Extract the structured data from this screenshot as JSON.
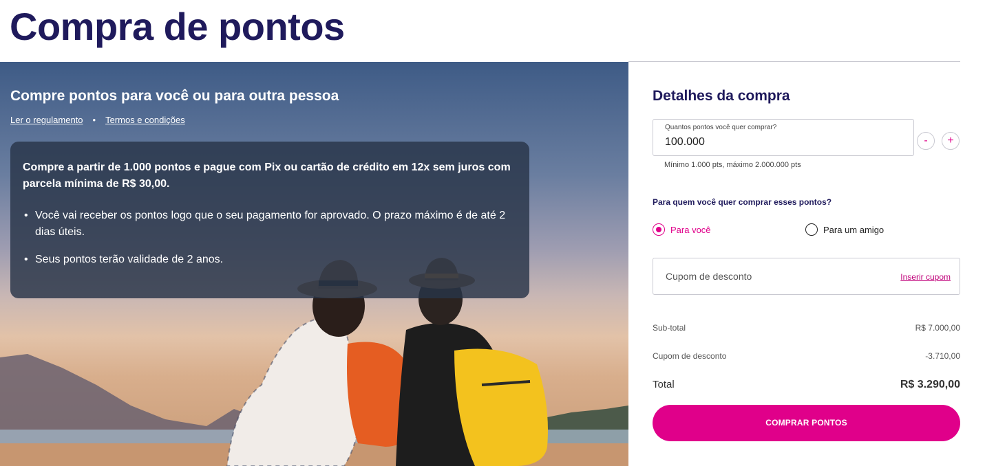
{
  "page": {
    "title": "Compra de pontos"
  },
  "hero": {
    "heading": "Compre pontos para você ou para outra pessoa",
    "links": [
      {
        "label": "Ler o regulamento"
      },
      {
        "label": "Termos e condições"
      }
    ],
    "separator": "•",
    "info": {
      "intro": "Compre a partir de 1.000 pontos e pague com Pix ou cartão de crédito em 12x sem juros com parcela mínima de R$ 30,00.",
      "bullets": [
        "Você vai receber os pontos logo que o seu pagamento for aprovado. O prazo máximo é de até 2 dias úteis.",
        "Seus pontos terão validade de 2 anos."
      ]
    },
    "image_description_icon": "beach-couple-photo"
  },
  "purchase": {
    "title": "Detalhes da compra",
    "points_field": {
      "label": "Quantos pontos você quer comprar?",
      "value": "100.000",
      "hint": "Mínimo 1.000 pts, máximo 2.000.000 pts"
    },
    "stepper": {
      "minus": "-",
      "plus": "+"
    },
    "recipient": {
      "question": "Para quem você quer comprar esses pontos?",
      "options": [
        {
          "label": "Para você",
          "selected": true
        },
        {
          "label": "Para um amigo",
          "selected": false
        }
      ]
    },
    "coupon": {
      "placeholder": "Cupom de desconto",
      "link": "Inserir cupom"
    },
    "summary": {
      "subtotal_label": "Sub-total",
      "subtotal_value": "R$ 7.000,00",
      "discount_label": "Cupom de desconto",
      "discount_value": "-3.710,00",
      "total_label": "Total",
      "total_value": "R$ 3.290,00"
    },
    "buy_button": "COMPRAR PONTOS"
  },
  "colors": {
    "brand_navy": "#1f1a5c",
    "accent_pink": "#e0008a",
    "border": "#c9c9d1"
  }
}
